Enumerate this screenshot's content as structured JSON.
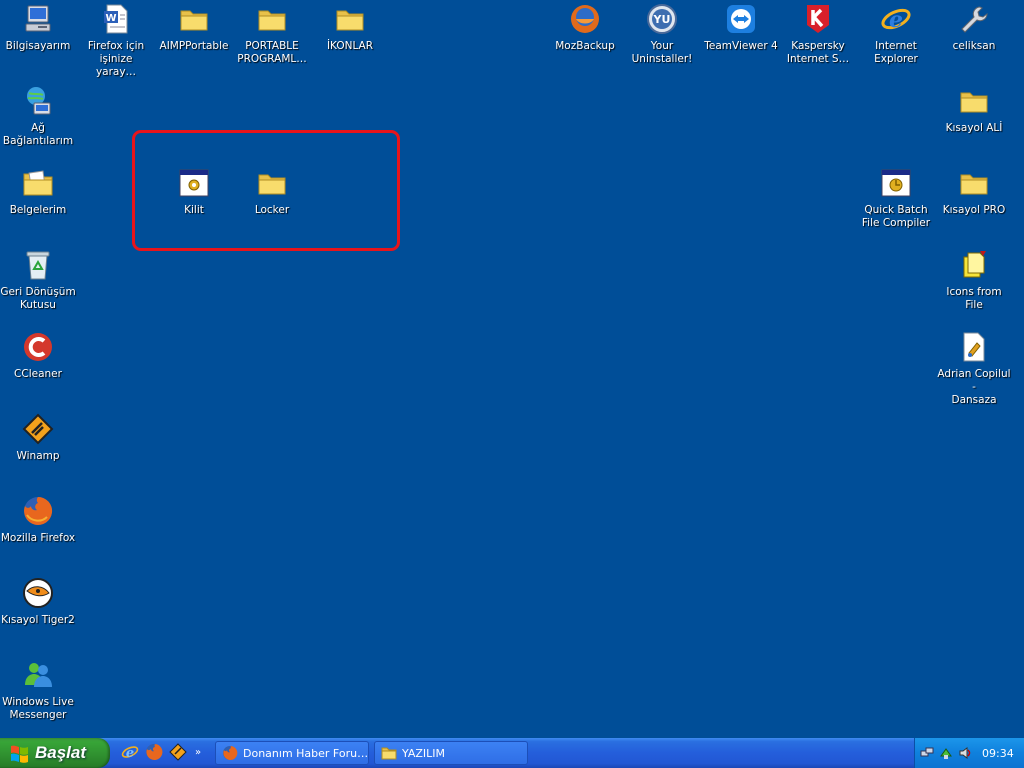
{
  "desktop": {
    "icons": {
      "bilgisayarim": "Bilgisayarım",
      "firefox_icin": "Firefox için\nişinize yaray…",
      "aimp": "AIMPPortable",
      "portable": "PORTABLE\nPROGRAML…",
      "ikonlar": "İKONLAR",
      "mozbackup": "MozBackup",
      "your_uninstaller": "Your\nUninstaller!",
      "teamviewer": "TeamViewer 4",
      "kaspersky": "Kaspersky\nInternet S…",
      "internet_explorer": "Internet\nExplorer",
      "celiksan": "celiksan",
      "ag_baglantilarim": "Ağ\nBağlantılarım",
      "kisayol_ali": "Kısayol ALİ",
      "belgelerim": "Belgelerim",
      "kilit": "Kilit",
      "locker": "Locker",
      "quick_batch": "Quick Batch\nFile Compiler",
      "kisayol_pro": "Kısayol PRO",
      "geri_donusum": "Geri Dönüşüm\nKutusu",
      "icons_from_file": "Icons from File",
      "ccleaner": "CCleaner",
      "adrian": "Adrian Copilul -\nDansaza",
      "winamp": "Winamp",
      "mozilla_firefox": "Mozilla Firefox",
      "kisayol_tiger": "Kısayol Tiger2",
      "wlm": "Windows Live\nMessenger"
    },
    "highlight_color": "#e8141b",
    "background_color": "#004e98"
  },
  "taskbar": {
    "start_label": "Başlat",
    "quick_launch_more": "»",
    "tasks": [
      "Donanım Haber Foru…",
      "YAZILIM"
    ],
    "clock": "09:34"
  }
}
